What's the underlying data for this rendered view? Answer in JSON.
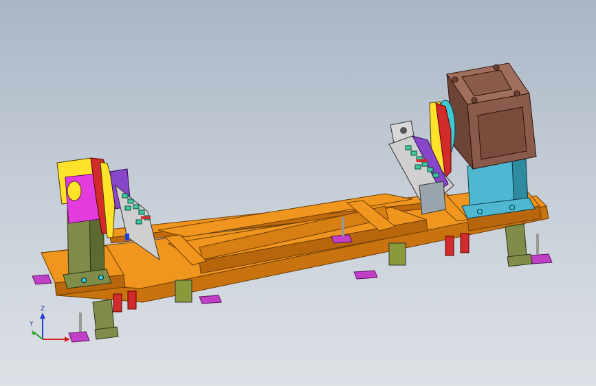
{
  "scene": {
    "type": "cad-3d-model",
    "background": {
      "top": "#a9b6c6",
      "bottom": "#dde1e6"
    },
    "colors": {
      "frame": "#f0961e",
      "frame_dark": "#b8660c",
      "tailstock_yellow": "#ffe22a",
      "tailstock_magenta": "#e43bde",
      "column_green": "#7f8c4a",
      "gearbox_brown": "#8a5a4a",
      "motor_base_cyan": "#4fb8d0",
      "clamp_green": "#3fc9a0",
      "foot_magenta": "#c040c8",
      "red_block": "#d12b2b",
      "olive_plate": "#8a9a3a"
    }
  },
  "triad": {
    "z_label": "Z",
    "y_label": "Y",
    "x_color": "#d62020",
    "y_color": "#1fa21f",
    "z_color": "#2040d8"
  }
}
